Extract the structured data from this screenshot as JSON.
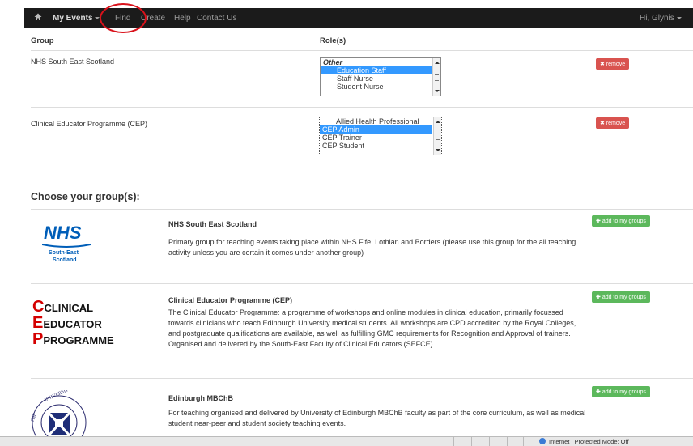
{
  "navbar": {
    "brand": "My Events",
    "items": [
      "Find",
      "Create",
      "Help",
      "Contact Us"
    ],
    "user": "Hi, Glynis"
  },
  "table": {
    "headers": [
      "Group",
      "Role(s)"
    ],
    "rows": [
      {
        "group": "NHS South East Scotland",
        "options": [
          "Other",
          "Education Staff",
          "Staff Nurse",
          "Student Nurse"
        ],
        "remove": "remove"
      },
      {
        "group": "Clinical Educator Programme (CEP)",
        "options": [
          "Allied Health Professional",
          "CEP Admin",
          "CEP Trainer",
          "CEP Student"
        ],
        "remove": "remove"
      }
    ]
  },
  "choose": {
    "title": "Choose your group(s):",
    "groups": [
      {
        "title": "NHS South East Scotland",
        "description": "Primary group for teaching events taking place within NHS Fife, Lothian and Borders (please use this group for the all teaching activity unless you are certain it comes under another group)",
        "logo": {
          "main": "NHS",
          "sub1": "South-East",
          "sub2": "Scotland"
        },
        "add": "add to my groups"
      },
      {
        "title": "Clinical Educator Programme (CEP)",
        "description": "The Clinical Educator Programme: a programme of workshops and online modules in clinical education, primarily focussed towards clinicians who teach Edinburgh University medical students. All workshops are CPD accredited by the Royal Colleges, and postgraduate qualifications are available, as well as fulfilling GMC requirements for Recognition and Approval of trainers. Organised and delivered by the South-East Faculty of Clinical Educators (SEFCE).",
        "logo": {
          "line1": "CLINICAL",
          "line2": "EDUCATOR",
          "line3": "PROGRAMME"
        },
        "add": "add to my groups"
      },
      {
        "title": "Edinburgh MBChB",
        "description": "For teaching organised and delivered by University of Edinburgh MBChB faculty as part of the core curriculum, as well as medical student near-peer and student society teaching events.",
        "add": "add to my groups"
      }
    ]
  },
  "statusbar": {
    "text": "Internet | Protected Mode: Off"
  },
  "colors": {
    "navbar": "#1b1b1b",
    "remove": "#d9534f",
    "add": "#5cb85c",
    "selection": "#3399ff",
    "nhs_blue": "#005eb8",
    "cep_red": "#d40000"
  }
}
